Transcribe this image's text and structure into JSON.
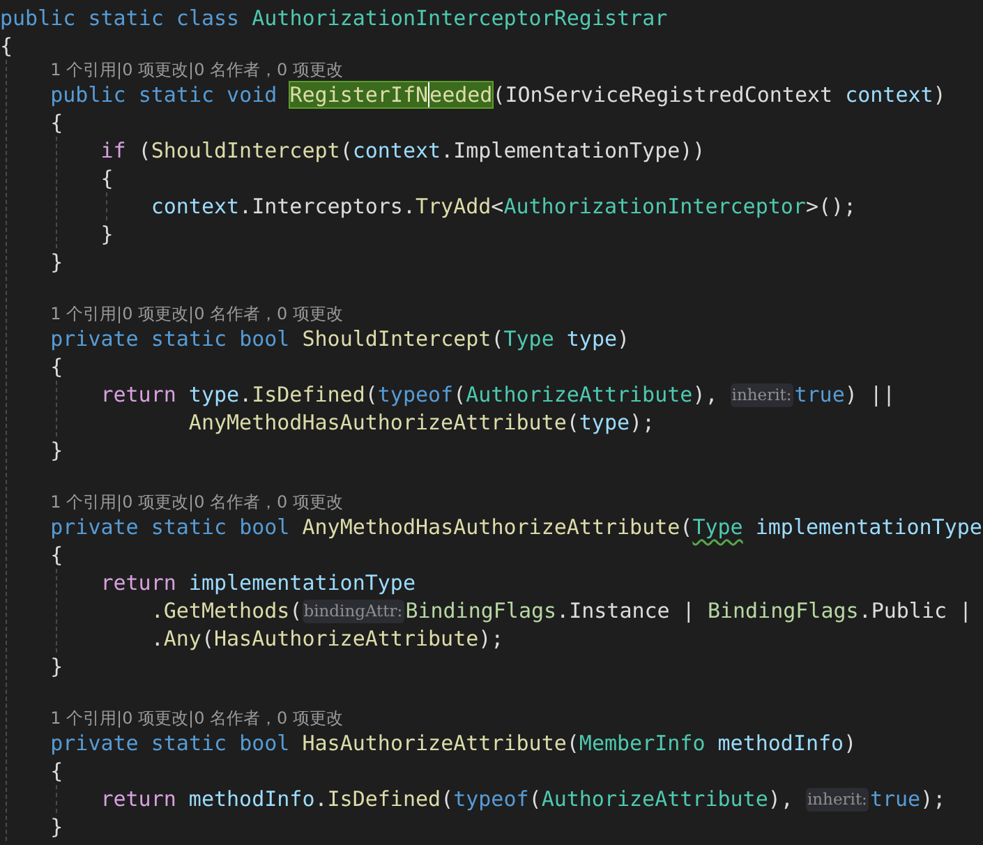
{
  "lines": [
    {
      "kind": "code",
      "tokens": [
        {
          "kind": "kw",
          "s": "public static class "
        },
        {
          "kind": "type",
          "s": "AuthorizationInterceptorRegistrar"
        }
      ]
    },
    {
      "kind": "code",
      "tokens": [
        {
          "kind": "p",
          "s": "{"
        }
      ]
    },
    {
      "kind": "block",
      "children": [
        {
          "kind": "lens",
          "text": "1 个引用|0 项更改|0 名作者，0 项更改"
        },
        {
          "kind": "code",
          "tokens": [
            {
              "kind": "kw",
              "s": "public static void "
            },
            {
              "kind": "hl",
              "s": "RegisterIfN",
              "caret": true
            },
            {
              "kind": "hl",
              "s": "eeded",
              "caret": false
            },
            {
              "kind": "p",
              "s": "(IOnServiceRegistredContext "
            },
            {
              "kind": "id",
              "s": "context"
            },
            {
              "kind": "p",
              "s": ")"
            }
          ]
        },
        {
          "kind": "code",
          "tokens": [
            {
              "kind": "p",
              "s": "{"
            }
          ]
        },
        {
          "kind": "block",
          "children": [
            {
              "kind": "code",
              "tokens": [
                {
                  "kind": "ctl",
                  "s": "if"
                },
                {
                  "kind": "p",
                  "s": " ("
                },
                {
                  "kind": "fn",
                  "s": "ShouldIntercept"
                },
                {
                  "kind": "p",
                  "s": "("
                },
                {
                  "kind": "id",
                  "s": "context"
                },
                {
                  "kind": "p",
                  "s": ".ImplementationType))"
                }
              ]
            },
            {
              "kind": "code",
              "tokens": [
                {
                  "kind": "p",
                  "s": "{"
                }
              ]
            },
            {
              "kind": "block",
              "children": [
                {
                  "kind": "code",
                  "tokens": [
                    {
                      "kind": "id",
                      "s": "context"
                    },
                    {
                      "kind": "p",
                      "s": ".Interceptors."
                    },
                    {
                      "kind": "fn",
                      "s": "TryAdd"
                    },
                    {
                      "kind": "p",
                      "s": "<"
                    },
                    {
                      "kind": "type",
                      "s": "AuthorizationInterceptor"
                    },
                    {
                      "kind": "p",
                      "s": ">();"
                    }
                  ]
                }
              ]
            },
            {
              "kind": "code",
              "tokens": [
                {
                  "kind": "p",
                  "s": "}"
                }
              ]
            }
          ]
        },
        {
          "kind": "code",
          "tokens": [
            {
              "kind": "p",
              "s": "}"
            }
          ]
        },
        {
          "kind": "blank"
        },
        {
          "kind": "lens",
          "text": "1 个引用|0 项更改|0 名作者，0 项更改"
        },
        {
          "kind": "code",
          "tokens": [
            {
              "kind": "kw",
              "s": "private static bool "
            },
            {
              "kind": "fn",
              "s": "ShouldIntercept"
            },
            {
              "kind": "p",
              "s": "("
            },
            {
              "kind": "type",
              "s": "Type"
            },
            {
              "kind": "id",
              "s": " type"
            },
            {
              "kind": "p",
              "s": ")"
            }
          ]
        },
        {
          "kind": "code",
          "tokens": [
            {
              "kind": "p",
              "s": "{"
            }
          ]
        },
        {
          "kind": "block",
          "children": [
            {
              "kind": "code",
              "tokens": [
                {
                  "kind": "ctl",
                  "s": "return"
                },
                {
                  "kind": "id",
                  "s": " type"
                },
                {
                  "kind": "p",
                  "s": "."
                },
                {
                  "kind": "fn",
                  "s": "IsDefined"
                },
                {
                  "kind": "p",
                  "s": "("
                },
                {
                  "kind": "kw",
                  "s": "typeof"
                },
                {
                  "kind": "p",
                  "s": "("
                },
                {
                  "kind": "type",
                  "s": "AuthorizeAttribute"
                },
                {
                  "kind": "p",
                  "s": "), "
                },
                {
                  "kind": "hint",
                  "s": "inherit:"
                },
                {
                  "kind": "kw",
                  "s": "true"
                },
                {
                  "kind": "p",
                  "s": ") ||"
                }
              ],
              "children": [
                {
                  "kind": "aligned",
                  "tokens": [
                    {
                      "kind": "fn",
                      "s": "AnyMethodHasAuthorizeAttribute"
                    },
                    {
                      "kind": "p",
                      "s": "("
                    },
                    {
                      "kind": "id",
                      "s": "type"
                    },
                    {
                      "kind": "p",
                      "s": ");"
                    }
                  ]
                }
              ]
            }
          ]
        },
        {
          "kind": "code",
          "tokens": [
            {
              "kind": "p",
              "s": "}"
            }
          ]
        },
        {
          "kind": "blank"
        },
        {
          "kind": "lens",
          "text": "1 个引用|0 项更改|0 名作者，0 项更改"
        },
        {
          "kind": "code",
          "tokens": [
            {
              "kind": "kw",
              "s": "private static bool "
            },
            {
              "kind": "fn",
              "s": "AnyMethodHasAuthorizeAttribute"
            },
            {
              "kind": "p",
              "s": "("
            },
            {
              "kind": "type",
              "s": "Type",
              "squiggle": true
            },
            {
              "kind": "id",
              "s": " implementationType"
            }
          ]
        },
        {
          "kind": "code",
          "tokens": [
            {
              "kind": "p",
              "s": "{"
            }
          ]
        },
        {
          "kind": "block",
          "children": [
            {
              "kind": "code",
              "tokens": [
                {
                  "kind": "ctl",
                  "s": "return"
                },
                {
                  "kind": "id",
                  "s": " implementationType"
                }
              ],
              "children": [
                {
                  "kind": "chained",
                  "tokens": [
                    {
                      "kind": "fn",
                      "s": ".GetMethods"
                    },
                    {
                      "kind": "p",
                      "s": "("
                    },
                    {
                      "kind": "hint",
                      "s": "bindingAttr:"
                    },
                    {
                      "kind": "enum",
                      "s": "BindingFlags"
                    },
                    {
                      "kind": "p",
                      "s": ".Instance | "
                    },
                    {
                      "kind": "enum",
                      "s": "BindingFlags"
                    },
                    {
                      "kind": "p",
                      "s": ".Public |"
                    }
                  ]
                },
                {
                  "kind": "chained",
                  "tokens": [
                    {
                      "kind": "p",
                      "s": "."
                    },
                    {
                      "kind": "fn",
                      "s": "Any"
                    },
                    {
                      "kind": "p",
                      "s": "("
                    },
                    {
                      "kind": "fn",
                      "s": "HasAuthorizeAttribute"
                    },
                    {
                      "kind": "p",
                      "s": ");"
                    }
                  ]
                }
              ]
            }
          ]
        },
        {
          "kind": "code",
          "tokens": [
            {
              "kind": "p",
              "s": "}"
            }
          ]
        },
        {
          "kind": "blank"
        },
        {
          "kind": "lens",
          "text": "1 个引用|0 项更改|0 名作者，0 项更改"
        },
        {
          "kind": "code",
          "tokens": [
            {
              "kind": "kw",
              "s": "private static bool "
            },
            {
              "kind": "fn",
              "s": "HasAuthorizeAttribute"
            },
            {
              "kind": "p",
              "s": "("
            },
            {
              "kind": "type",
              "s": "MemberInfo"
            },
            {
              "kind": "id",
              "s": " methodInfo"
            },
            {
              "kind": "p",
              "s": ")"
            }
          ]
        },
        {
          "kind": "code",
          "tokens": [
            {
              "kind": "p",
              "s": "{"
            }
          ]
        },
        {
          "kind": "block",
          "children": [
            {
              "kind": "code",
              "tokens": [
                {
                  "kind": "ctl",
                  "s": "return"
                },
                {
                  "kind": "id",
                  "s": " methodInfo"
                },
                {
                  "kind": "p",
                  "s": "."
                },
                {
                  "kind": "fn",
                  "s": "IsDefined"
                },
                {
                  "kind": "p",
                  "s": "("
                },
                {
                  "kind": "kw",
                  "s": "typeof"
                },
                {
                  "kind": "p",
                  "s": "("
                },
                {
                  "kind": "type",
                  "s": "AuthorizeAttribute"
                },
                {
                  "kind": "p",
                  "s": "), "
                },
                {
                  "kind": "hint",
                  "s": "inherit:"
                },
                {
                  "kind": "kw",
                  "s": "true"
                },
                {
                  "kind": "p",
                  "s": ");"
                }
              ]
            }
          ]
        },
        {
          "kind": "code",
          "tokens": [
            {
              "kind": "p",
              "s": "}"
            }
          ]
        }
      ]
    }
  ]
}
